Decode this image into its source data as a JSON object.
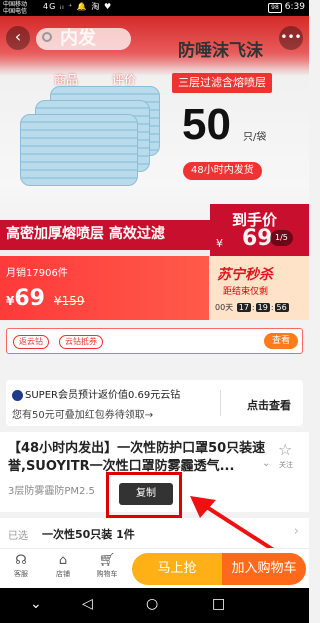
{
  "status_bar": {
    "carrier1": "中国移动",
    "carrier2": "中国电信",
    "icons": "4G ᵢₗ ⁺ 🔔 淘 ♥",
    "battery": "98",
    "time": "6:39"
  },
  "hero": {
    "promo_text": "内发",
    "brand_text": "防唾沫飞沫",
    "tabs": [
      "商品",
      "评价"
    ],
    "layer_badge": "三层过滤含熔喷层",
    "big_number": "50",
    "unit": "只/袋",
    "ship_pill": "48小时内发货",
    "banner": "高密加厚熔喷层  高效过滤",
    "price_box_title": "到手价",
    "price_box_currency": "¥",
    "price_box_value": "69",
    "image_counter": "1/5",
    "colors": {
      "accent": "#c8102e",
      "badge": "#e33333"
    }
  },
  "flash_sale": {
    "sales": "月销17906件",
    "currency": "¥",
    "price": "69",
    "old_price": "¥159",
    "title": "苏宁秒杀",
    "subtitle": "距结束仅剩",
    "days": "00天",
    "h": "17",
    "m": "19",
    "s": "56"
  },
  "coupons": {
    "tag1": "返云钻",
    "tag2": "云钻抵券",
    "check": "查看"
  },
  "super": {
    "line1": "SUPER会员预计返价值0.69元云钻",
    "line2": "您有50元可叠加红包券待领取→",
    "link": "点击查看"
  },
  "product": {
    "title": "【48小时内发出】一次性防护口罩50只装速誉,SUOYITR一次性口罩防雾霾透气...",
    "subtitle": "3层防雾霾防PM2.5",
    "follow": "关注"
  },
  "context_menu": {
    "copy": "复制"
  },
  "selection": {
    "label": "已选",
    "value": "一次性50只装  1件"
  },
  "bottom_bar": {
    "service": "客服",
    "shop": "店铺",
    "cart": "购物车",
    "buy_now": "马上抢",
    "add_cart": "加入购物车"
  }
}
